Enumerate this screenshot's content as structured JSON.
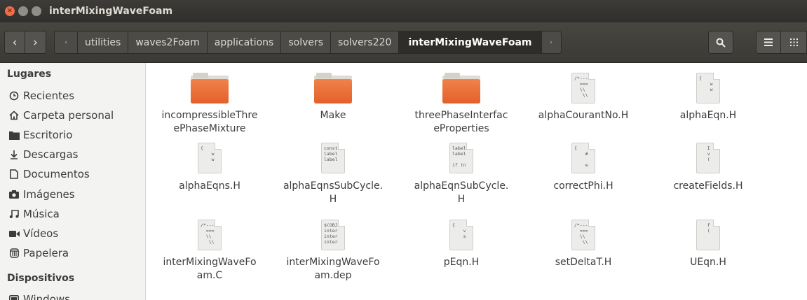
{
  "window": {
    "title": "interMixingWaveFoam"
  },
  "toolbar": {
    "back_label": "‹",
    "forward_label": "›",
    "crumb_left_arrow": "‹",
    "crumbs": [
      "utilities",
      "waves2Foam",
      "applications",
      "solvers",
      "solvers220",
      "interMixingWaveFoam"
    ],
    "crumb_right_arrow": "›",
    "search_icon": "search-icon",
    "menu_icon": "hamburger-menu-icon",
    "grid_icon": "grid-view-icon"
  },
  "sidebar": {
    "places_heading": "Lugares",
    "places": [
      {
        "label": "Recientes",
        "icon": "clock-icon"
      },
      {
        "label": "Carpeta personal",
        "icon": "home-icon"
      },
      {
        "label": "Escritorio",
        "icon": "desktop-folder-icon"
      },
      {
        "label": "Descargas",
        "icon": "download-icon"
      },
      {
        "label": "Documentos",
        "icon": "document-icon"
      },
      {
        "label": "Imágenes",
        "icon": "camera-icon"
      },
      {
        "label": "Música",
        "icon": "music-icon"
      },
      {
        "label": "Vídeos",
        "icon": "video-icon"
      },
      {
        "label": "Papelera",
        "icon": "trash-icon"
      }
    ],
    "devices_heading": "Dispositivos",
    "devices": [
      {
        "label": "Windows",
        "icon": "drive-icon"
      }
    ]
  },
  "files": [
    {
      "name": "incompressibleThreePhaseMixture",
      "line1": "incompressibleThre",
      "line2": "ePhaseMixture",
      "type": "folder"
    },
    {
      "name": "Make",
      "line1": "Make",
      "line2": "",
      "type": "folder"
    },
    {
      "name": "threePhaseInterfaceProperties",
      "line1": "threePhaseInterfac",
      "line2": "eProperties",
      "type": "folder"
    },
    {
      "name": "alphaCourantNo.H",
      "line1": "alphaCourantNo.H",
      "line2": "",
      "type": "text",
      "preview": "/*---\n  ===\n  \\\\\n   \\\\"
    },
    {
      "name": "alphaEqn.H",
      "line1": "alphaEqn.H",
      "line2": "",
      "type": "text",
      "preview": "{\n    w\n    w"
    },
    {
      "name": "alphaEqns.H",
      "line1": "alphaEqns.H",
      "line2": "",
      "type": "text",
      "preview": "{\n    w\n    w"
    },
    {
      "name": "alphaEqnsSubCycle.H",
      "line1": "alphaEqnsSubCycle.",
      "line2": "H",
      "type": "text",
      "preview": "const\nlabel\nlabel"
    },
    {
      "name": "alphaEqnSubCycle.H",
      "line1": "alphaEqnSubCycle.",
      "line2": "H",
      "type": "text",
      "preview": "label\nlabel\n\nif (n"
    },
    {
      "name": "correctPhi.H",
      "line1": "correctPhi.H",
      "line2": "",
      "type": "text",
      "preview": "{\n    #\n\n    w"
    },
    {
      "name": "createFields.H",
      "line1": "createFields.H",
      "line2": "",
      "type": "text",
      "preview": "   I\n   v\n   ("
    },
    {
      "name": "interMixingWaveFoam.C",
      "line1": "interMixingWaveFo",
      "line2": "am.C",
      "type": "text",
      "preview": "/*---\n  ===\n  \\\\\n   \\\\"
    },
    {
      "name": "interMixingWaveFoam.dep",
      "line1": "interMixingWaveFo",
      "line2": "am.dep",
      "type": "text",
      "preview": "$(OBJ\ninter\ninter\ninter"
    },
    {
      "name": "pEqn.H",
      "line1": "pEqn.H",
      "line2": "",
      "type": "text",
      "preview": "{\n    v\n    s"
    },
    {
      "name": "setDeltaT.H",
      "line1": "setDeltaT.H",
      "line2": "",
      "type": "text",
      "preview": "/*---\n  ===\n  \\\\\n   \\\\"
    },
    {
      "name": "UEqn.H",
      "line1": "UEqn.H",
      "line2": "",
      "type": "text",
      "preview": "   f\n   ("
    }
  ],
  "colors": {
    "titlebar": "#3d3c38",
    "folder": "#e9692f",
    "accent": "#ef6d48"
  }
}
